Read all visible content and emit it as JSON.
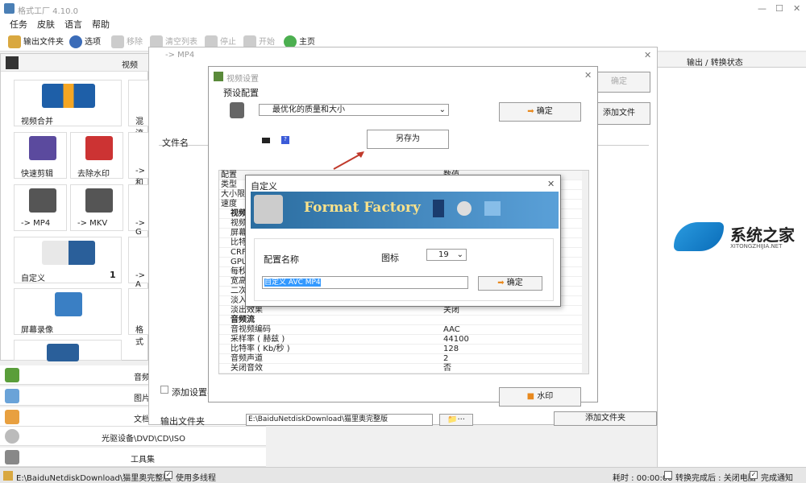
{
  "app": {
    "title": "格式工厂 4.10.0"
  },
  "menu": [
    "任务",
    "皮肤",
    "语言",
    "帮助"
  ],
  "toolbar": {
    "output_folder": "输出文件夹",
    "options": "选项",
    "remove": "移除",
    "clear": "清空列表",
    "stop": "停止",
    "start": "开始",
    "home": "主页"
  },
  "left": {
    "video_header": "视频",
    "tiles": [
      {
        "label": "视频合并"
      },
      {
        "label": "混流"
      },
      {
        "label": "快速剪辑"
      },
      {
        "label": "去除水印"
      },
      {
        "label": "-> 和"
      },
      {
        "label": "-> MP4"
      },
      {
        "label": "-> MKV"
      },
      {
        "label": "-> G"
      },
      {
        "label": "自定义",
        "count": "1"
      },
      {
        "label": "-> A"
      },
      {
        "label": "屏幕录像"
      },
      {
        "label": "格式"
      }
    ],
    "categories": [
      "音频",
      "图片",
      "文档",
      "光驱设备\\DVD\\CD\\ISO",
      "工具集"
    ]
  },
  "right": {
    "header": "输出 / 转换状态"
  },
  "mp4window": {
    "title": "-> MP4",
    "file_name_col": "文件名",
    "confirm": "确定",
    "add_file": "添加文件",
    "add_settings": "添加设置名",
    "output_folder_label": "输出文件夹",
    "output_path": "E:\\BaiduNetdiskDownload\\猫里奥完整版",
    "add_folder": "添加文件夹"
  },
  "video_settings": {
    "title": "视频设置",
    "preset_label": "预设配置",
    "preset_value": "最优化的质量和大小",
    "confirm": "确定",
    "save_as": "另存为",
    "watermark": "水印",
    "table": {
      "col_config": "配置",
      "col_value": "数值"
    },
    "rows": [
      {
        "k": "类型",
        "v": ""
      },
      {
        "k": "大小限",
        "v": ""
      },
      {
        "k": "速度",
        "v": ""
      },
      {
        "k": "视频",
        "v": ""
      },
      {
        "k": "视频",
        "v": ""
      },
      {
        "k": "屏幕",
        "v": ""
      },
      {
        "k": "比特",
        "v": ""
      },
      {
        "k": "CRF",
        "v": ""
      },
      {
        "k": "GPU",
        "v": ""
      },
      {
        "k": "每秒",
        "v": ""
      },
      {
        "k": "宽高",
        "v": ""
      },
      {
        "k": "二次",
        "v": ""
      },
      {
        "k": "淡入",
        "v": ""
      },
      {
        "k": "淡出效果",
        "v": "关闭"
      },
      {
        "k": "音频流",
        "v": ""
      },
      {
        "k": "音视频编码",
        "v": "AAC"
      },
      {
        "k": "采样率 ( 赫兹 )",
        "v": "44100"
      },
      {
        "k": "比特率 ( Kb/秒 )",
        "v": "128"
      },
      {
        "k": "音频声道",
        "v": "2"
      },
      {
        "k": "关闭音效",
        "v": "否"
      }
    ]
  },
  "custom": {
    "title": "自定义",
    "banner": "Format Factory",
    "config_name_label": "配置名称",
    "icon_label": "图标",
    "icon_value": "19",
    "config_name_value": "自定义 AVC MP4",
    "confirm": "确定"
  },
  "watermark_text": {
    "main": "系统之家",
    "sub": "XITONGZHIJIA.NET"
  },
  "status": {
    "path": "E:\\BaiduNetdiskDownload\\猫里奥完整版",
    "multithread": "使用多线程",
    "elapsed": "耗时 : 00:00:00",
    "after": "转换完成后 : 关闭电脑",
    "notify": "完成通知"
  }
}
